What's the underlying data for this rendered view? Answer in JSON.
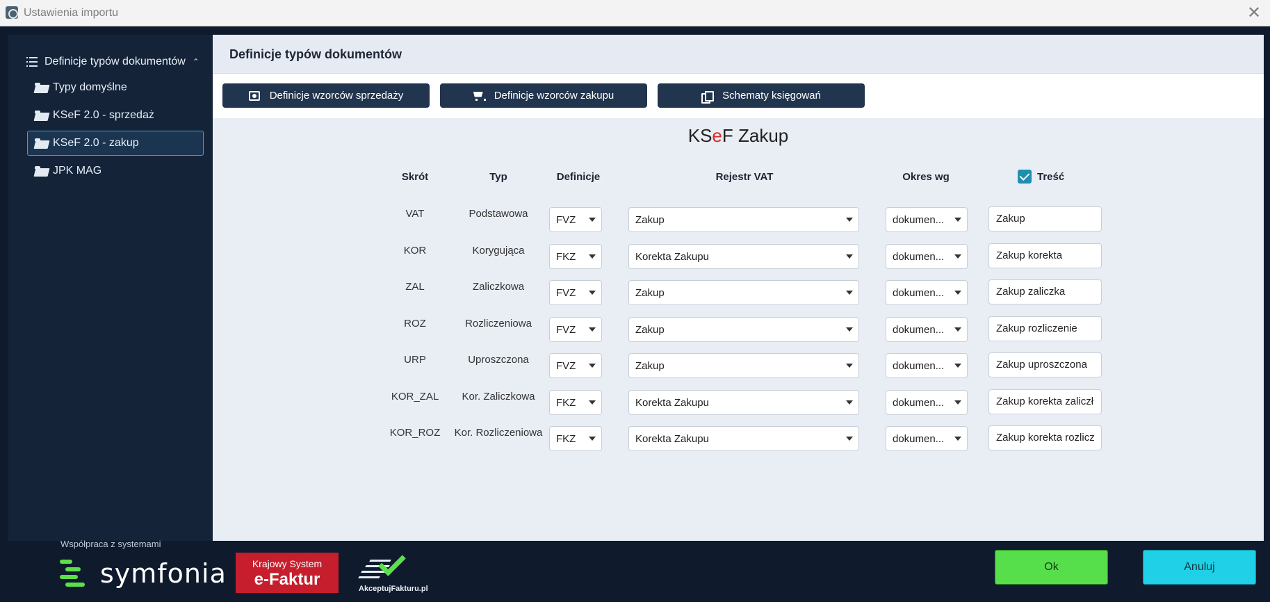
{
  "window": {
    "title": "Ustawienia importu"
  },
  "sidebar": {
    "header": "Definicje typów dokumentów",
    "items": [
      {
        "label": "Typy domyślne",
        "active": false
      },
      {
        "label": "KSeF 2.0 - sprzedaż",
        "active": false
      },
      {
        "label": "KSeF 2.0 - zakup",
        "active": true
      },
      {
        "label": "JPK MAG",
        "active": false
      }
    ]
  },
  "main": {
    "heading": "Definicje typów dokumentów",
    "toolbar": {
      "sales_label": "Definicje wzorców sprzedaży",
      "purchase_label": "Definicje wzorców zakupu",
      "schemes_label": "Schematy księgowań"
    },
    "section_title": {
      "prefix": "KS",
      "accent": "e",
      "suffix": "F Zakup"
    },
    "columns": {
      "skrot": "Skrót",
      "typ": "Typ",
      "definicje": "Definicje",
      "rejestr": "Rejestr VAT",
      "okres": "Okres wg",
      "tresc": "Treść"
    },
    "tresc_checked": true,
    "rows": [
      {
        "skrot": "VAT",
        "typ": "Podstawowa",
        "definicja": "FVZ",
        "rejestr": "Zakup",
        "okres": "dokumen...",
        "tresc": "Zakup"
      },
      {
        "skrot": "KOR",
        "typ": "Korygująca",
        "definicja": "FKZ",
        "rejestr": "Korekta Zakupu",
        "okres": "dokumen...",
        "tresc": "Zakup korekta"
      },
      {
        "skrot": "ZAL",
        "typ": "Zaliczkowa",
        "definicja": "FVZ",
        "rejestr": "Zakup",
        "okres": "dokumen...",
        "tresc": "Zakup zaliczka"
      },
      {
        "skrot": "ROZ",
        "typ": "Rozliczeniowa",
        "definicja": "FVZ",
        "rejestr": "Zakup",
        "okres": "dokumen...",
        "tresc": "Zakup rozliczenie"
      },
      {
        "skrot": "URP",
        "typ": "Uproszczona",
        "definicja": "FVZ",
        "rejestr": "Zakup",
        "okres": "dokumen...",
        "tresc": "Zakup uproszczona"
      },
      {
        "skrot": "KOR_ZAL",
        "typ": "Kor. Zaliczkowa",
        "definicja": "FKZ",
        "rejestr": "Korekta Zakupu",
        "okres": "dokumen...",
        "tresc": "Zakup korekta zaliczł"
      },
      {
        "skrot": "KOR_ROZ",
        "typ": "Kor. Rozliczeniowa",
        "definicja": "FKZ",
        "rejestr": "Korekta Zakupu",
        "okres": "dokumen...",
        "tresc": "Zakup korekta rozlicz"
      }
    ]
  },
  "footer": {
    "note": "Współpraca z systemami",
    "symfonia": "symfonia",
    "efaktur_line1": "Krajowy System",
    "efaktur_line2": "e-Faktur",
    "akcept": "AkceptujFakturu.pl",
    "ok_label": "Ok",
    "cancel_label": "Anuluj"
  },
  "colors": {
    "background": "#0f1b2d",
    "sidebar": "#142338",
    "active_border": "#3aa6c9",
    "toolbar_button": "#22354e",
    "ok": "#57de4b",
    "cancel": "#1fd0e6",
    "accent_red": "#d62b2b"
  }
}
